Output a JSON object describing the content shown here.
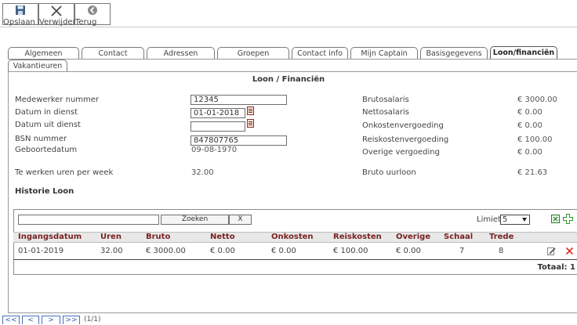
{
  "toolbar": {
    "save_label": "Opslaan",
    "delete_label": "Verwijder",
    "back_label": "Terug"
  },
  "tabs": {
    "algemeen": "Algemeen",
    "contact": "Contact",
    "adressen": "Adressen",
    "groepen": "Groepen",
    "contactinfo": "Contact info",
    "mijncaptain": "Mijn Captain",
    "basisgegevens": "Basisgegevens",
    "loon": "Loon/financiën",
    "vakantieuren": "Vakantieuren"
  },
  "section_title": "Loon / Financiën",
  "fields": {
    "medewerker_label": "Medewerker nummer",
    "medewerker_value": "12345",
    "in_dienst_label": "Datum in dienst",
    "in_dienst_value": "01-01-2018",
    "uit_dienst_label": "Datum uit dienst",
    "uit_dienst_value": "",
    "bsn_label": "BSN nummer",
    "bsn_value": "847807765",
    "geboorte_label": "Geboortedatum",
    "geboorte_value": "09-08-1970",
    "uren_label": "Te werken uren per week",
    "uren_value": "32.00"
  },
  "salary": {
    "bruto_label": "Brutosalaris",
    "bruto_value": "€ 3000.00",
    "netto_label": "Nettosalaris",
    "netto_value": "€ 0.00",
    "onkosten_label": "Onkostenvergoeding",
    "onkosten_value": "€ 0.00",
    "reiskosten_label": "Reiskostenvergoeding",
    "reiskosten_value": "€ 100.00",
    "overige_label": "Overige vergoeding",
    "overige_value": "€ 0.00",
    "uurloon_label": "Bruto uurloon",
    "uurloon_value": "€ 21.63"
  },
  "history": {
    "title": "Historie Loon",
    "search_placeholder": "",
    "search_button": "Zoeken",
    "clear_button": "X",
    "limit_label": "Limiet",
    "limit_value": "5",
    "columns": [
      "Ingangsdatum",
      "Uren",
      "Bruto",
      "Netto",
      "Onkosten",
      "Reiskosten",
      "Overige",
      "Schaal",
      "Trede"
    ],
    "rows": [
      [
        "01-01-2019",
        "32.00",
        "€ 3000.00",
        "€ 0.00",
        "€ 0.00",
        "€ 100.00",
        "€ 0.00",
        "7",
        "8"
      ]
    ],
    "total": "Totaal: 1"
  },
  "pager": {
    "first": "<<",
    "prev": "<",
    "next": ">",
    "last": ">>",
    "info": "(1/1)"
  },
  "icons": {
    "save": "floppy-disk-icon",
    "delete": "x-cross-icon",
    "back": "back-arrow-icon",
    "calendar": "calendar-icon",
    "excel": "excel-export-icon",
    "add": "green-plus-icon",
    "edit": "pencil-edit-icon",
    "remove": "red-x-delete-icon"
  },
  "colors": {
    "header_text": "#7a2323",
    "pager_blue": "#3a5bb0",
    "delete_red": "#d9321f",
    "add_green": "#2c9a2c"
  }
}
